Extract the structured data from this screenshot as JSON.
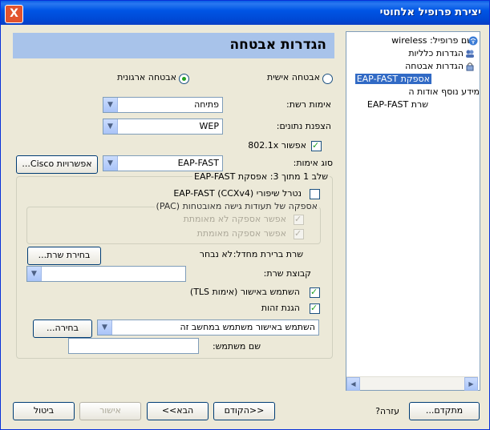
{
  "window": {
    "title": "יצירת פרופיל אלחוטי",
    "close_symbol": "X"
  },
  "header": {
    "title": "הגדרות אבטחה"
  },
  "security_type": {
    "personal": "אבטחה אישית",
    "enterprise": "אבטחה ארגונית",
    "selected": "enterprise"
  },
  "network_auth": {
    "label": "אימות רשת:",
    "value": "פתיחה"
  },
  "data_encryption": {
    "label": "הצפנת נתונים:",
    "value": "WEP"
  },
  "enable_8021x": {
    "label": "אפשור 802.1x",
    "checked": true
  },
  "auth_type": {
    "label": "סוג אימות:",
    "value": "EAP-FAST",
    "options_button": "אפשרויות Cisco..."
  },
  "stage_group": {
    "legend": "שלב 1 מתוך 3: אפסקת EAP-FAST",
    "cisco_ext": {
      "label": "נטרל שיפורי EAP-FAST (CCXv4)",
      "checked": false
    },
    "pac_group": {
      "legend": "אספקה של תעודות גישה מאובטחות (PAC)",
      "allow_unauth": {
        "label": "אפשר אספקה לא מאומתת",
        "checked": true
      },
      "allow_auth": {
        "label": "אפשר אספקה מאומתת",
        "checked": true
      }
    },
    "server_default": {
      "label": "שרת ברירת מחדל:",
      "value": "לא נבחר",
      "button": "בחירת שרת..."
    },
    "server_group": {
      "label": "קבוצת שרת:",
      "value": ""
    },
    "use_cert": {
      "label": "השתמש באישור (אימות TLS)",
      "checked": true
    },
    "identity_protection": {
      "label": "הגנת זהות",
      "checked": true
    },
    "cert_combo": {
      "value": "השתמש באישור משתמש במחשב זה"
    },
    "select_button": "בחירה...",
    "username": {
      "label": "שם משתמש:",
      "value": ""
    }
  },
  "tree": {
    "items": [
      {
        "label": "שם פרופיל: wireless",
        "icon": "wireless-icon"
      },
      {
        "label": "הגדרות כלליות",
        "icon": "users-icon"
      },
      {
        "label": "הגדרות אבטחה",
        "icon": "lock-icon"
      },
      {
        "label": "אספקת EAP-FAST",
        "icon": "",
        "selected": true
      },
      {
        "label": "מידע נוסף אודות ה",
        "icon": ""
      },
      {
        "label": "שרת EAP-FAST",
        "icon": ""
      }
    ]
  },
  "footer": {
    "advanced": "מתקדם...",
    "help": "עזרה?",
    "back": "<<הקודם",
    "next": "הבא>>",
    "ok": "אישור",
    "cancel": "ביטול"
  },
  "colors": {
    "title_bar": "#0055e5",
    "header_bg": "#a8c3ea",
    "dialog_bg": "#ece9d8",
    "selection": "#316ac5"
  }
}
